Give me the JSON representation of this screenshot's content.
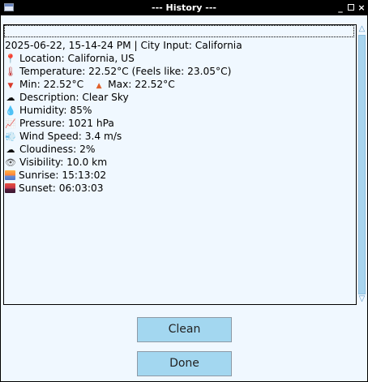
{
  "window": {
    "title": "--- History ---",
    "controls": {
      "minimize_glyph": "_",
      "close_glyph": "×"
    }
  },
  "history": {
    "entry_header": "2025-06-22, 15-14-24 PM | City Input: California",
    "location": "Location: California, US",
    "temperature": "Temperature: 22.52°C (Feels like: 23.05°C)",
    "min": "Min: 22.52°C",
    "max": "Max: 22.52°C",
    "description": "Description: Clear Sky",
    "humidity": "Humidity: 85%",
    "pressure": "Pressure: 1021 hPa",
    "wind_speed": "Wind Speed: 3.4 m/s",
    "cloudiness": "Cloudiness: 2%",
    "visibility": "Visibility: 10.0 km",
    "sunrise": "Sunrise: 15:13:02",
    "sunset": "Sunset: 06:03:03"
  },
  "icons": {
    "location": "round-pushpin-icon",
    "temperature": "thermometer-icon",
    "min": "down-triangle-icon",
    "max": "up-triangle-icon",
    "description": "cloud-icon",
    "humidity": "droplet-icon",
    "pressure": "chart-increasing-icon",
    "wind_speed": "wind-icon",
    "cloudiness": "cloud-icon",
    "visibility": "eye-icon",
    "sunrise": "sunrise-icon",
    "sunset": "sunset-icon"
  },
  "buttons": {
    "clean_label": "Clean",
    "done_label": "Done"
  },
  "colors": {
    "background": "#f0f8ff",
    "button": "#a3d7f0",
    "titlebar": "#000000",
    "scroll_thumb": "#a8d4ee"
  }
}
